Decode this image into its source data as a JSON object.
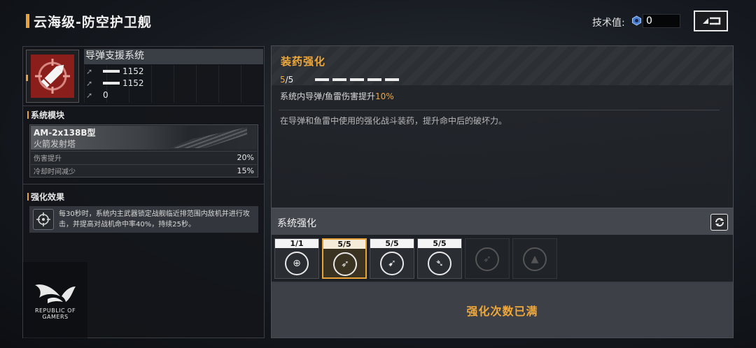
{
  "header": {
    "title": "云海级-防空护卫舰",
    "tech_label": "技术值:",
    "tech_value": "0"
  },
  "left": {
    "system_name": "导弹支援系统",
    "stats": [
      {
        "icon": "missile-stat-icon",
        "value": "1152"
      },
      {
        "icon": "torpedo-stat-icon",
        "value": "1152"
      },
      {
        "icon": "reload-stat-icon",
        "value": "0"
      }
    ],
    "module_section_title": "系统模块",
    "module": {
      "name": "AM-2x138B型",
      "type": "火箭发射塔",
      "rows": [
        {
          "label": "伤害提升",
          "value": "20%"
        },
        {
          "label": "冷却时间减少",
          "value": "15%"
        }
      ]
    },
    "effect_section_title": "强化效果",
    "effect_text": "每30秒时，系统内主武器锁定战舰临近排范围内敌机并进行攻击，并提高对战机命中率40%，持续25秒。",
    "rog_text": "REPUBLIC OF GAMERS"
  },
  "detail": {
    "title": "装药强化",
    "level_current": "5",
    "level_max": "/5",
    "level_fill": 1.0,
    "effect_prefix": "系统内导弹/鱼雷伤害提升",
    "effect_value": "10%",
    "description": "在导弹和鱼雷中使用的强化战斗装药，提升命中后的破坏力。"
  },
  "system_upgrade": {
    "title": "系统强化",
    "slots": [
      {
        "count": "1/1",
        "icon": "target-lock-icon",
        "glyph": "⊕",
        "state": "normal"
      },
      {
        "count": "5/5",
        "icon": "missile-charge-icon",
        "glyph": "➶",
        "state": "selected"
      },
      {
        "count": "5/5",
        "icon": "twin-missile-icon",
        "glyph": "➹",
        "state": "normal"
      },
      {
        "count": "5/5",
        "icon": "torpedo-icon",
        "glyph": "➴",
        "state": "normal"
      },
      {
        "count": "",
        "icon": "locked-missile-icon",
        "glyph": "➶",
        "state": "locked"
      },
      {
        "count": "",
        "icon": "locked-radar-icon",
        "glyph": "▲",
        "state": "locked"
      }
    ],
    "footer_text": "强化次数已满"
  },
  "colors": {
    "accent": "#f0a83a",
    "panel": "#1d2025"
  }
}
